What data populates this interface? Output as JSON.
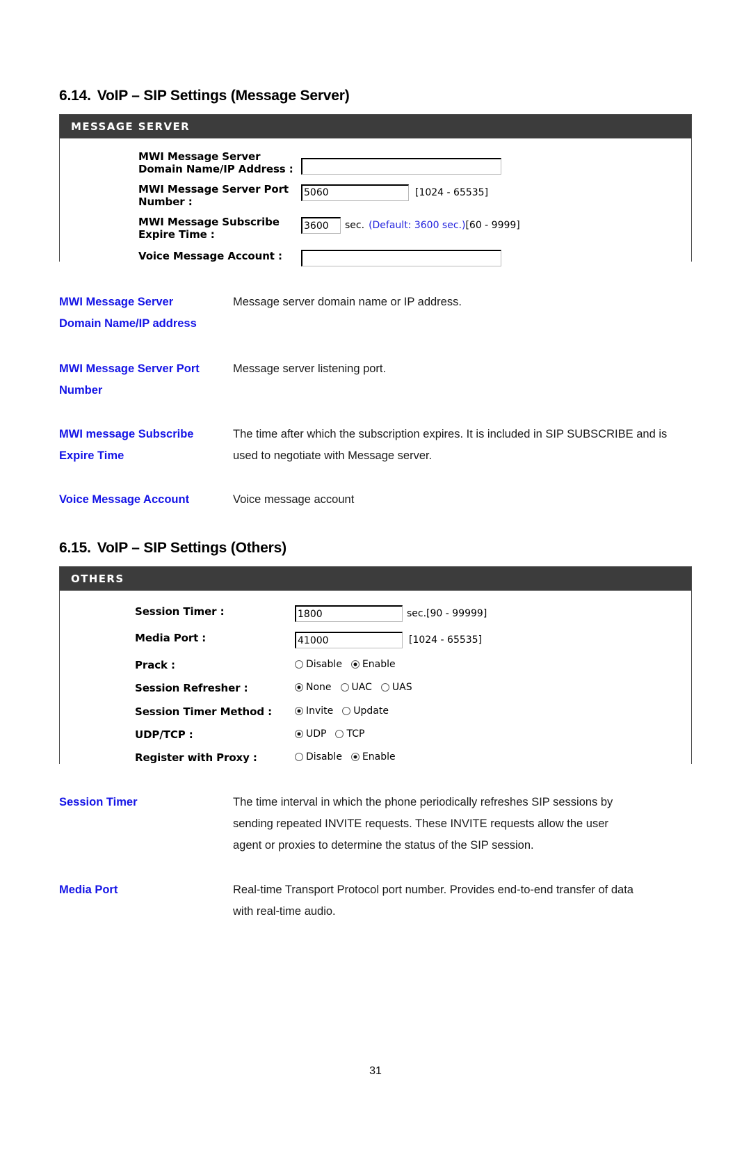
{
  "document": {
    "page_number": "31"
  },
  "sections": [
    {
      "number": "6.14.",
      "title": "VoIP – SIP Settings (Message Server)"
    },
    {
      "number": "6.15.",
      "title": "VoIP – SIP Settings (Others)"
    }
  ],
  "message_server_panel": {
    "header": "MESSAGE SERVER",
    "rows": {
      "domain": {
        "label_line1": "MWI Message Server",
        "label_line2": "Domain Name/IP Address :",
        "value": "",
        "placeholder": ""
      },
      "port": {
        "label_line1": "MWI Message Server Port",
        "label_line2": "Number :",
        "value": "5060",
        "range_hint": "[1024 - 65535]"
      },
      "expire": {
        "label_line1": "MWI Message Subscribe",
        "label_line2": "Expire Time :",
        "value": "3600",
        "unit": "sec.",
        "default_note": "(Default: 3600 sec.)",
        "range_hint": "[60 - 9999]"
      },
      "account": {
        "label_line1": "Voice Message Account :",
        "value": "",
        "placeholder": ""
      }
    }
  },
  "message_server_descriptions": [
    {
      "term_line1": "MWI Message Server",
      "term_line2": "Domain Name/IP address",
      "text": "Message server domain name or IP address."
    },
    {
      "term_line1": "MWI Message Server Port",
      "term_line2": "Number",
      "text": "Message server listening port."
    },
    {
      "term_line1": "MWI message Subscribe",
      "term_line2": "Expire Time",
      "line1": "The time after which the subscription expires. It is included in SIP SUBSCRIBE",
      "line2": "and is used to negotiate with Message server."
    },
    {
      "term_line1": "Voice Message Account",
      "term_line2": "",
      "text": "Voice message account"
    }
  ],
  "others_panel": {
    "header": "OTHERS",
    "rows": {
      "session_timer": {
        "label": "Session Timer :",
        "value": "1800",
        "range_hint": "sec.[90 - 99999]"
      },
      "media_port": {
        "label": "Media Port :",
        "value": "41000",
        "range_hint": "[1024 - 65535]"
      },
      "prack": {
        "label": "Prack :",
        "options": [
          {
            "label": "Disable",
            "selected": false
          },
          {
            "label": "Enable",
            "selected": true
          }
        ]
      },
      "session_refresher": {
        "label": "Session Refresher :",
        "options": [
          {
            "label": "None",
            "selected": true
          },
          {
            "label": "UAC",
            "selected": false
          },
          {
            "label": "UAS",
            "selected": false
          }
        ]
      },
      "session_timer_method": {
        "label": "Session Timer Method :",
        "options": [
          {
            "label": "Invite",
            "selected": true
          },
          {
            "label": "Update",
            "selected": false
          }
        ]
      },
      "udp_tcp": {
        "label": "UDP/TCP :",
        "options": [
          {
            "label": "UDP",
            "selected": true
          },
          {
            "label": "TCP",
            "selected": false
          }
        ]
      },
      "register_with_proxy": {
        "label": "Register with Proxy :",
        "options": [
          {
            "label": "Disable",
            "selected": false
          },
          {
            "label": "Enable",
            "selected": true
          }
        ]
      }
    }
  },
  "others_descriptions": [
    {
      "term_line1": "Session Timer",
      "term_line2": "",
      "line1": "The time interval in which the phone periodically refreshes SIP sessions by",
      "line2": "sending repeated INVITE requests. These INVITE requests allow the user",
      "line3": "agent or proxies to determine the status of the SIP session."
    },
    {
      "term_line1": "Media Port",
      "term_line2": "",
      "line1": "Real-time Transport Protocol port number. Provides end-to-end transfer of data",
      "line2": "with real-time audio."
    }
  ]
}
